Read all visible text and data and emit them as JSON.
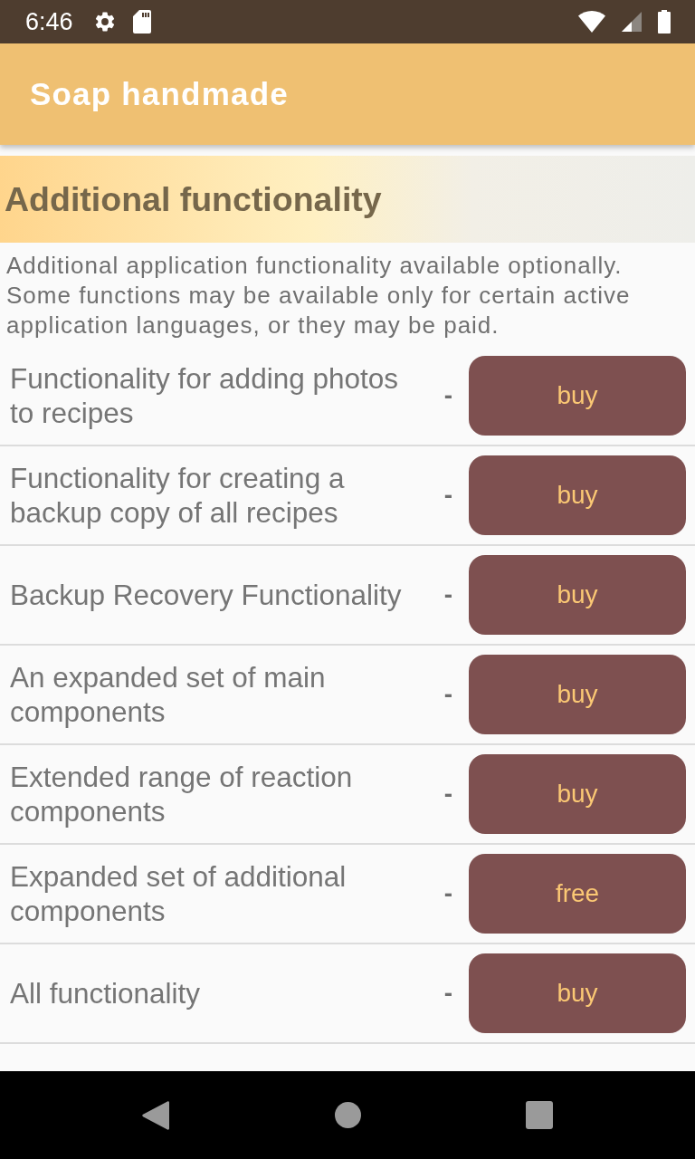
{
  "status_bar": {
    "time": "6:46"
  },
  "app_bar": {
    "title": "Soap handmade"
  },
  "section": {
    "title": "Additional functionality",
    "description": "Additional application functionality available optionally. Some functions may be available only for certain active application languages, or they may be paid."
  },
  "features": [
    {
      "name": "Functionality for adding photos to recipes",
      "dash": "-",
      "action": "buy"
    },
    {
      "name": "Functionality for creating a backup copy of all recipes",
      "dash": "-",
      "action": "buy"
    },
    {
      "name": "Backup Recovery Functionality",
      "dash": "-",
      "action": "buy"
    },
    {
      "name": "An expanded set of main components",
      "dash": "-",
      "action": "buy"
    },
    {
      "name": "Extended range of reaction components",
      "dash": "-",
      "action": "buy"
    },
    {
      "name": "Expanded set of additional components",
      "dash": "-",
      "action": "free"
    },
    {
      "name": "All functionality",
      "dash": "-",
      "action": "buy"
    }
  ]
}
